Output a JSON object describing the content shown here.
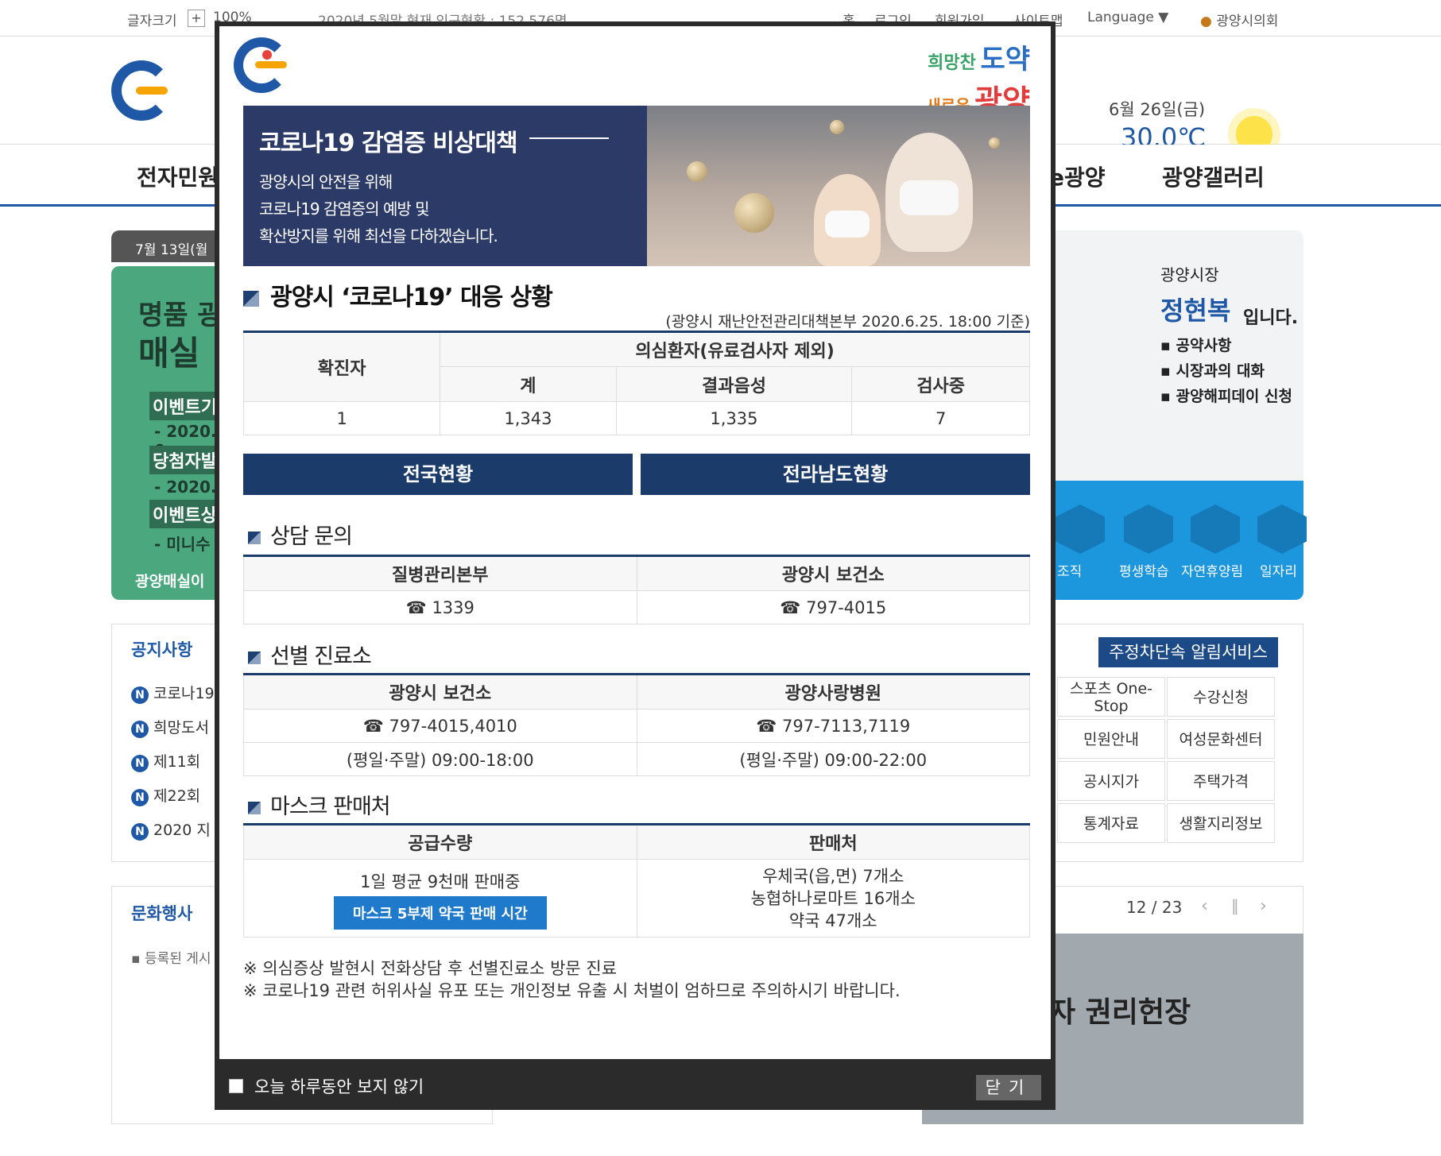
{
  "topbar": {
    "font_size_label": "글자크기",
    "zoom": "100%",
    "population": "2020년 5월말 현재 인구현황 : 152,576명",
    "links": [
      "홈",
      "로그인",
      "회원가입",
      "사이트맵"
    ],
    "language": "Language ▼",
    "council": "광양시의회"
  },
  "weather": {
    "date": "6월 26일(금)",
    "temp": "30.0℃"
  },
  "nav": {
    "items": [
      "전자민원",
      "e광양",
      "광양갤러리"
    ]
  },
  "left": {
    "date": "7월 13일(월",
    "green": [
      "명품 광",
      "매실",
      "이벤트기",
      "- 2020. 0",
      "당첨자발",
      "- 2020. 1",
      "이벤트상",
      "- 미니수"
    ],
    "green_caption": "광양매실이"
  },
  "notice": {
    "title": "공지사항",
    "items": [
      "코로나19",
      "희망도서",
      "제11회",
      "제22회",
      "2020 지"
    ]
  },
  "culture": {
    "title": "문화행사",
    "empty": "등록된 게시"
  },
  "mayor": {
    "title": "광양시장",
    "name": "정현복",
    "suffix": "입니다.",
    "links": [
      "공약사항",
      "시장과의 대화",
      "광양해피데이 신청"
    ]
  },
  "quick": {
    "items": [
      "조직",
      "평생학습",
      "자연휴양림",
      "일자리"
    ]
  },
  "services": {
    "head": "주정차단속 알림서비스",
    "items": [
      "스포츠 One-Stop",
      "수강신청",
      "민원안내",
      "여성문화센터",
      "공시지가",
      "주택가격",
      "통계자료",
      "생활지리정보"
    ]
  },
  "rotator": {
    "page": "12 / 23",
    "title": "자 권리헌장"
  },
  "popup": {
    "slogan": {
      "a": "희망찬",
      "b": "도약",
      "c": "새로운",
      "d": "광양"
    },
    "banner": {
      "title": "코로나19 감염증 비상대책",
      "lines": [
        "광양시의 안전을 위해",
        "코로나19 감염증의 예방 및",
        "확산방지를 위해 최선을 다하겠습니다."
      ]
    },
    "status_title": "광양시 ‘코로나19’ 대응 상황",
    "status_note": "(광양시 재난안전관리대책본부 2020.6.25. 18:00 기준)",
    "status_table": {
      "confirmed_h": "확진자",
      "suspect_h": "의심환자(유료검사자 제외)",
      "total_h": "계",
      "negative_h": "결과음성",
      "testing_h": "검사중",
      "confirmed": "1",
      "total": "1,343",
      "negative": "1,335",
      "testing": "7"
    },
    "btn_national": "전국현황",
    "btn_jeonnam": "전라남도현황",
    "consult_title": "상담 문의",
    "consult": {
      "h1": "질병관리본부",
      "h2": "광양시 보건소",
      "v1": "☎ 1339",
      "v2": "☎ 797-4015"
    },
    "clinic_title": "선별 진료소",
    "clinic": {
      "h1": "광양시 보건소",
      "h2": "광양사랑병원",
      "p1": "☎ 797-4015,4010",
      "p2": "☎ 797-7113,7119",
      "t1": "(평일·주말) 09:00-18:00",
      "t2": "(평일·주말) 09:00-22:00"
    },
    "mask_title": "마스크 판매처",
    "mask": {
      "h1": "공급수량",
      "h2": "판매처",
      "supply": "1일 평균 9천매 판매중",
      "btn": "마스크 5부제 약국 판매 시간",
      "s1": "우체국(읍,면) 7개소",
      "s2": "농협하나로마트 16개소",
      "s3": "약국 47개소"
    },
    "foot1": "※ 의심증상 발현시 전화상담 후 선별진료소 방문 진료",
    "foot2": "※ 코로나19 관련 허위사실 유포 또는 개인정보 유출 시 처벌이 엄하므로 주의하시기 바랍니다.",
    "dont_show": "오늘 하루동안 보지 않기",
    "close": "닫기"
  }
}
